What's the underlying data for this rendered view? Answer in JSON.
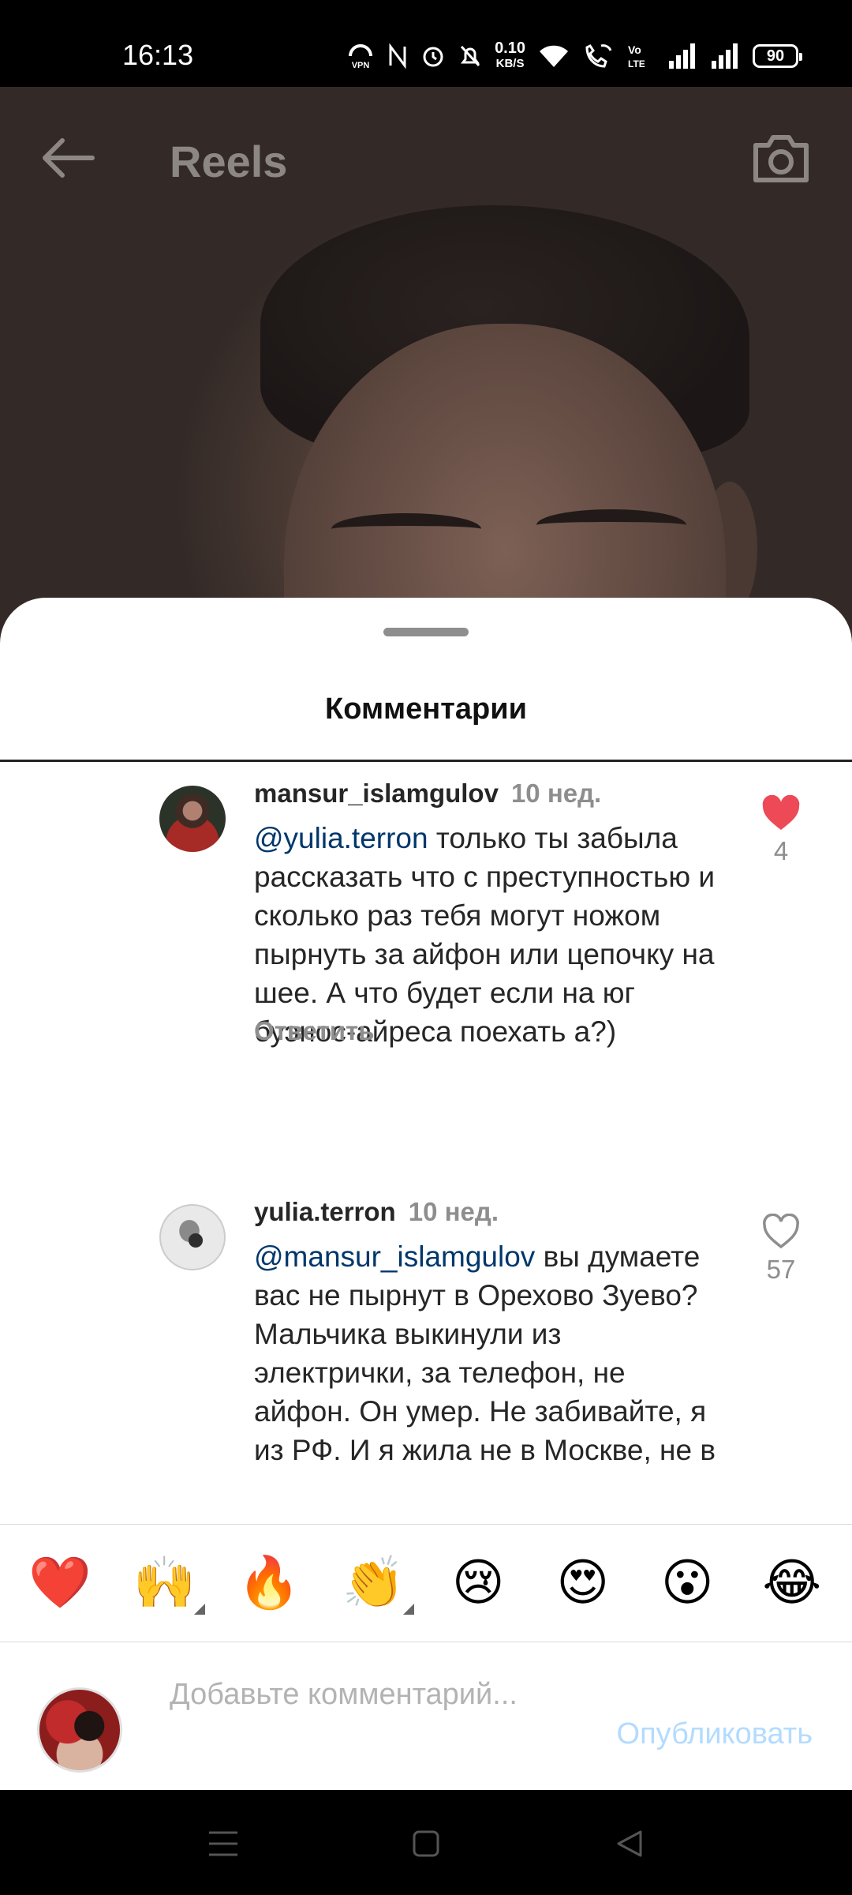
{
  "status_bar": {
    "time": "16:13",
    "speed_value": "0.10",
    "speed_unit": "KB/S",
    "battery": "90",
    "icons": [
      "vpn-icon",
      "nfc-icon",
      "alarm-icon",
      "mute-icon",
      "wifi-icon",
      "wifi-call-icon",
      "volte-icon",
      "signal-icon",
      "signal-icon",
      "battery-icon"
    ]
  },
  "header": {
    "title": "Reels",
    "back_icon": "arrow-left-icon",
    "camera_icon": "camera-icon"
  },
  "sheet": {
    "title": "Комментарии"
  },
  "comments": [
    {
      "username": "mansur_islamgulov",
      "time": "10 нед.",
      "mention": "@yulia.terron",
      "text": " только ты забыла рассказать что с преступностью и сколько раз тебя могут ножом пырнуть за айфон или цепочку на шее. А что будет если на юг буэнос-айреса поехать а?)",
      "reply_label": "Ответить",
      "likes": "4",
      "liked": true
    },
    {
      "username": "yulia.terron",
      "time": "10 нед.",
      "mention": "@mansur_islamgulov",
      "text": " вы думаете вас не пырнут в Орехово Зуево? Мальчика выкинули из электрички, за телефон, не айфон. Он умер. Не забивайте, я из РФ. И я жила не в Москве, не в",
      "likes": "57",
      "liked": false
    }
  ],
  "emoji_reactions": [
    "❤️",
    "🙌",
    "🔥",
    "👏",
    "😢",
    "😍",
    "😮",
    "😂"
  ],
  "composer": {
    "placeholder": "Добавьте комментарий...",
    "publish_label": "Опубликовать"
  },
  "colors": {
    "like_red": "#ed4956",
    "mention_blue": "#00376b",
    "publish_disabled": "#b3dbff",
    "secondary_text": "#8e8e8e"
  }
}
